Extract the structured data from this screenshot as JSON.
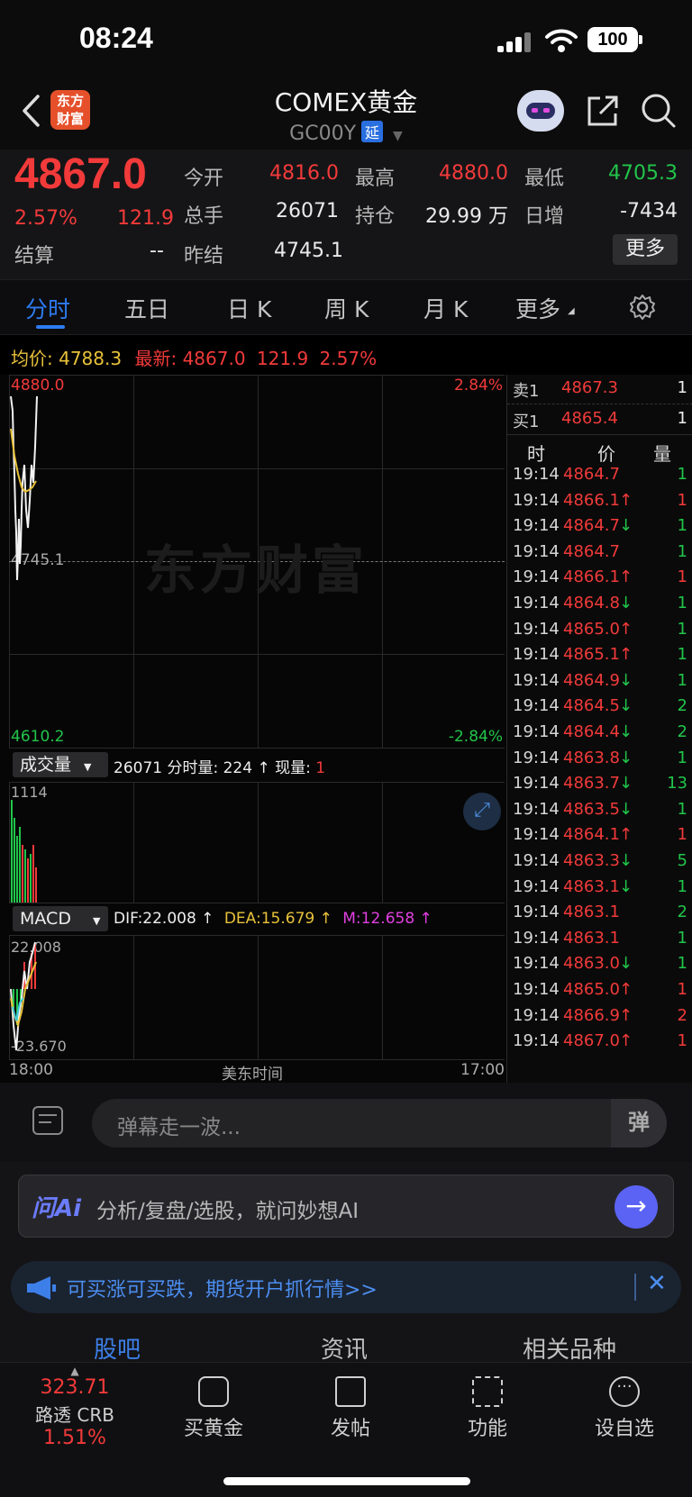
{
  "status_bar": {
    "time": "08:24",
    "battery": "100"
  },
  "header": {
    "logo_text": "东方财富",
    "title": "COMEX黄金",
    "code": "GC00Y",
    "delay_badge": "延"
  },
  "quote": {
    "price": "4867.0",
    "change_pct": "2.57%",
    "change": "121.9",
    "settle_label": "结算",
    "settle_value": "--",
    "rows": [
      {
        "l1": "今开",
        "v1": "4816.0",
        "l2": "最高",
        "v2": "4880.0",
        "l3": "最低",
        "v3": "4705.3"
      },
      {
        "l1": "总手",
        "v1": "26071",
        "l2": "持仓",
        "v2": "29.99 万",
        "l3": "日增",
        "v3": "-7434"
      },
      {
        "l1": "昨结",
        "v1": "4745.1"
      }
    ],
    "more_label": "更多"
  },
  "tabs": [
    "分时",
    "五日",
    "日 K",
    "周 K",
    "月 K",
    "更多"
  ],
  "info_line": {
    "avg_label": "均价:",
    "avg_value": "4788.3",
    "latest_label": "最新:",
    "latest_value": "4867.0",
    "change": "121.9",
    "change_pct": "2.57%"
  },
  "chart": {
    "price_high": "4880.0",
    "price_low": "4610.2",
    "pct_high": "2.84%",
    "pct_low": "-2.84%",
    "prev_settle": "4745.1",
    "watermark": "东方财富",
    "volume_selector": "成交量",
    "volume_info_prefix": "26071 分时量: 224 ↑ 现量: ",
    "volume_info_now": "1",
    "volume_max": "1114",
    "macd_selector": "MACD",
    "dif": "DIF:22.008 ↑",
    "dea": "DEA:15.679 ↑",
    "m": "M:12.658 ↑",
    "macd_high": "22.008",
    "macd_low": "-23.670",
    "time_start": "18:00",
    "time_mid": "美东时间",
    "time_end": "17:00"
  },
  "book": {
    "sell_label": "卖1",
    "sell_price": "4867.3",
    "sell_qty": "1",
    "buy_label": "买1",
    "buy_price": "4865.4",
    "buy_qty": "1",
    "headers": [
      "时",
      "价",
      "量"
    ],
    "ticks": [
      {
        "t": "19:14",
        "p": "4864.7",
        "a": "",
        "q": "1",
        "qc": "green"
      },
      {
        "t": "19:14",
        "p": "4866.1",
        "a": "↑",
        "q": "1",
        "qc": "red"
      },
      {
        "t": "19:14",
        "p": "4864.7",
        "a": "↓",
        "q": "1",
        "qc": "green"
      },
      {
        "t": "19:14",
        "p": "4864.7",
        "a": "",
        "q": "1",
        "qc": "green"
      },
      {
        "t": "19:14",
        "p": "4866.1",
        "a": "↑",
        "q": "1",
        "qc": "red"
      },
      {
        "t": "19:14",
        "p": "4864.8",
        "a": "↓",
        "q": "1",
        "qc": "green"
      },
      {
        "t": "19:14",
        "p": "4865.0",
        "a": "↑",
        "q": "1",
        "qc": "green"
      },
      {
        "t": "19:14",
        "p": "4865.1",
        "a": "↑",
        "q": "1",
        "qc": "green"
      },
      {
        "t": "19:14",
        "p": "4864.9",
        "a": "↓",
        "q": "1",
        "qc": "green"
      },
      {
        "t": "19:14",
        "p": "4864.5",
        "a": "↓",
        "q": "2",
        "qc": "green"
      },
      {
        "t": "19:14",
        "p": "4864.4",
        "a": "↓",
        "q": "2",
        "qc": "green"
      },
      {
        "t": "19:14",
        "p": "4863.8",
        "a": "↓",
        "q": "1",
        "qc": "green"
      },
      {
        "t": "19:14",
        "p": "4863.7",
        "a": "↓",
        "q": "13",
        "qc": "green"
      },
      {
        "t": "19:14",
        "p": "4863.5",
        "a": "↓",
        "q": "1",
        "qc": "green"
      },
      {
        "t": "19:14",
        "p": "4864.1",
        "a": "↑",
        "q": "1",
        "qc": "red"
      },
      {
        "t": "19:14",
        "p": "4863.3",
        "a": "↓",
        "q": "5",
        "qc": "green"
      },
      {
        "t": "19:14",
        "p": "4863.1",
        "a": "↓",
        "q": "1",
        "qc": "green"
      },
      {
        "t": "19:14",
        "p": "4863.1",
        "a": "",
        "q": "2",
        "qc": "green"
      },
      {
        "t": "19:14",
        "p": "4863.1",
        "a": "",
        "q": "1",
        "qc": "green"
      },
      {
        "t": "19:14",
        "p": "4863.0",
        "a": "↓",
        "q": "1",
        "qc": "green"
      },
      {
        "t": "19:14",
        "p": "4865.0",
        "a": "↑",
        "q": "1",
        "qc": "red"
      },
      {
        "t": "19:14",
        "p": "4866.9",
        "a": "↑",
        "q": "2",
        "qc": "red"
      },
      {
        "t": "19:14",
        "p": "4867.0",
        "a": "↑",
        "q": "1",
        "qc": "red"
      }
    ]
  },
  "comment": {
    "placeholder": "弹幕走一波...",
    "danmu_label": "弹"
  },
  "ai": {
    "logo": "问Ai",
    "placeholder": "分析/复盘/选股，就问妙想AI"
  },
  "promo": {
    "text": "可买涨可买跌，期货开户抓行情>>"
  },
  "sub_tabs": [
    "股吧",
    "资讯",
    "相关品种"
  ],
  "bottom_nav": {
    "index_value": "323.71",
    "index_name": "路透 CRB",
    "index_pct": "1.51%",
    "items": [
      "买黄金",
      "发帖",
      "功能",
      "设自选"
    ]
  },
  "colors": {
    "up": "#f23a3a",
    "down": "#21c54a",
    "accent": "#2d7bf0",
    "avg_line": "#e8c23a"
  }
}
